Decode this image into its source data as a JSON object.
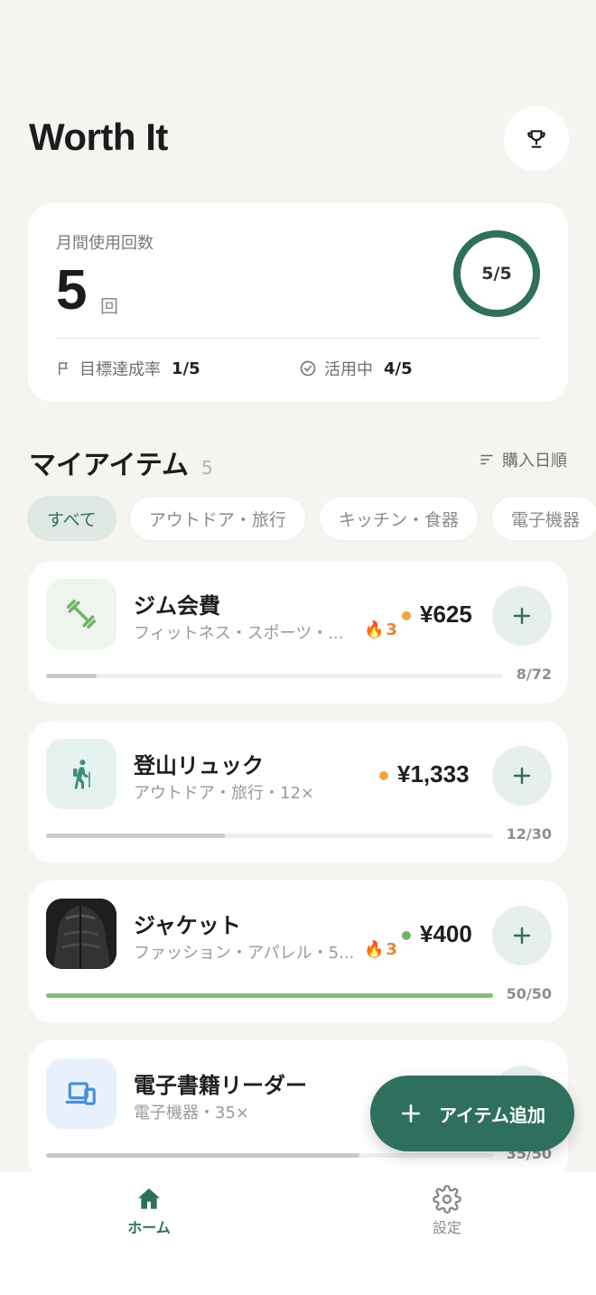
{
  "header": {
    "title": "Worth It",
    "trophy_icon": "trophy-icon"
  },
  "stats": {
    "label": "月間使用回数",
    "value": "5",
    "unit": "回",
    "ring_text": "5/5",
    "ring_progress": 1.0,
    "goal_label": "目標達成率",
    "goal_value": "1/5",
    "active_label": "活用中",
    "active_value": "4/5"
  },
  "section": {
    "title": "マイアイテム",
    "count": "5",
    "sort_label": "購入日順"
  },
  "filters": [
    "すべて",
    "アウトドア・旅行",
    "キッチン・食器",
    "電子機器"
  ],
  "items": [
    {
      "name": "ジム会費",
      "meta": "フィットネス・スポーツ・...",
      "streak": "3",
      "price": "¥625",
      "dot_color": "#f0a53a",
      "progress_text": "8/72",
      "progress": 0.111,
      "icon": "dumbbell-icon"
    },
    {
      "name": "登山リュック",
      "meta": "アウトドア・旅行・12×",
      "streak": "",
      "price": "¥1,333",
      "dot_color": "#f0a53a",
      "progress_text": "12/30",
      "progress": 0.4,
      "icon": "hiker-icon"
    },
    {
      "name": "ジャケット",
      "meta": "ファッション・アパレル・5...",
      "streak": "3",
      "price": "¥400",
      "dot_color": "#74b06a",
      "progress_text": "50/50",
      "progress": 1.0,
      "icon": "jacket-photo"
    },
    {
      "name": "電子書籍リーダー",
      "meta": "電子機器・35×",
      "streak": "",
      "price": "",
      "dot_color": "",
      "progress_text": "35/50",
      "progress": 0.7,
      "icon": "devices-icon"
    }
  ],
  "fab": {
    "label": "アイテム追加"
  },
  "tabbar": {
    "home": "ホーム",
    "settings": "設定"
  },
  "colors": {
    "accent": "#2f6f5d",
    "background": "#f5f4f0",
    "streak": "#e0873a"
  }
}
